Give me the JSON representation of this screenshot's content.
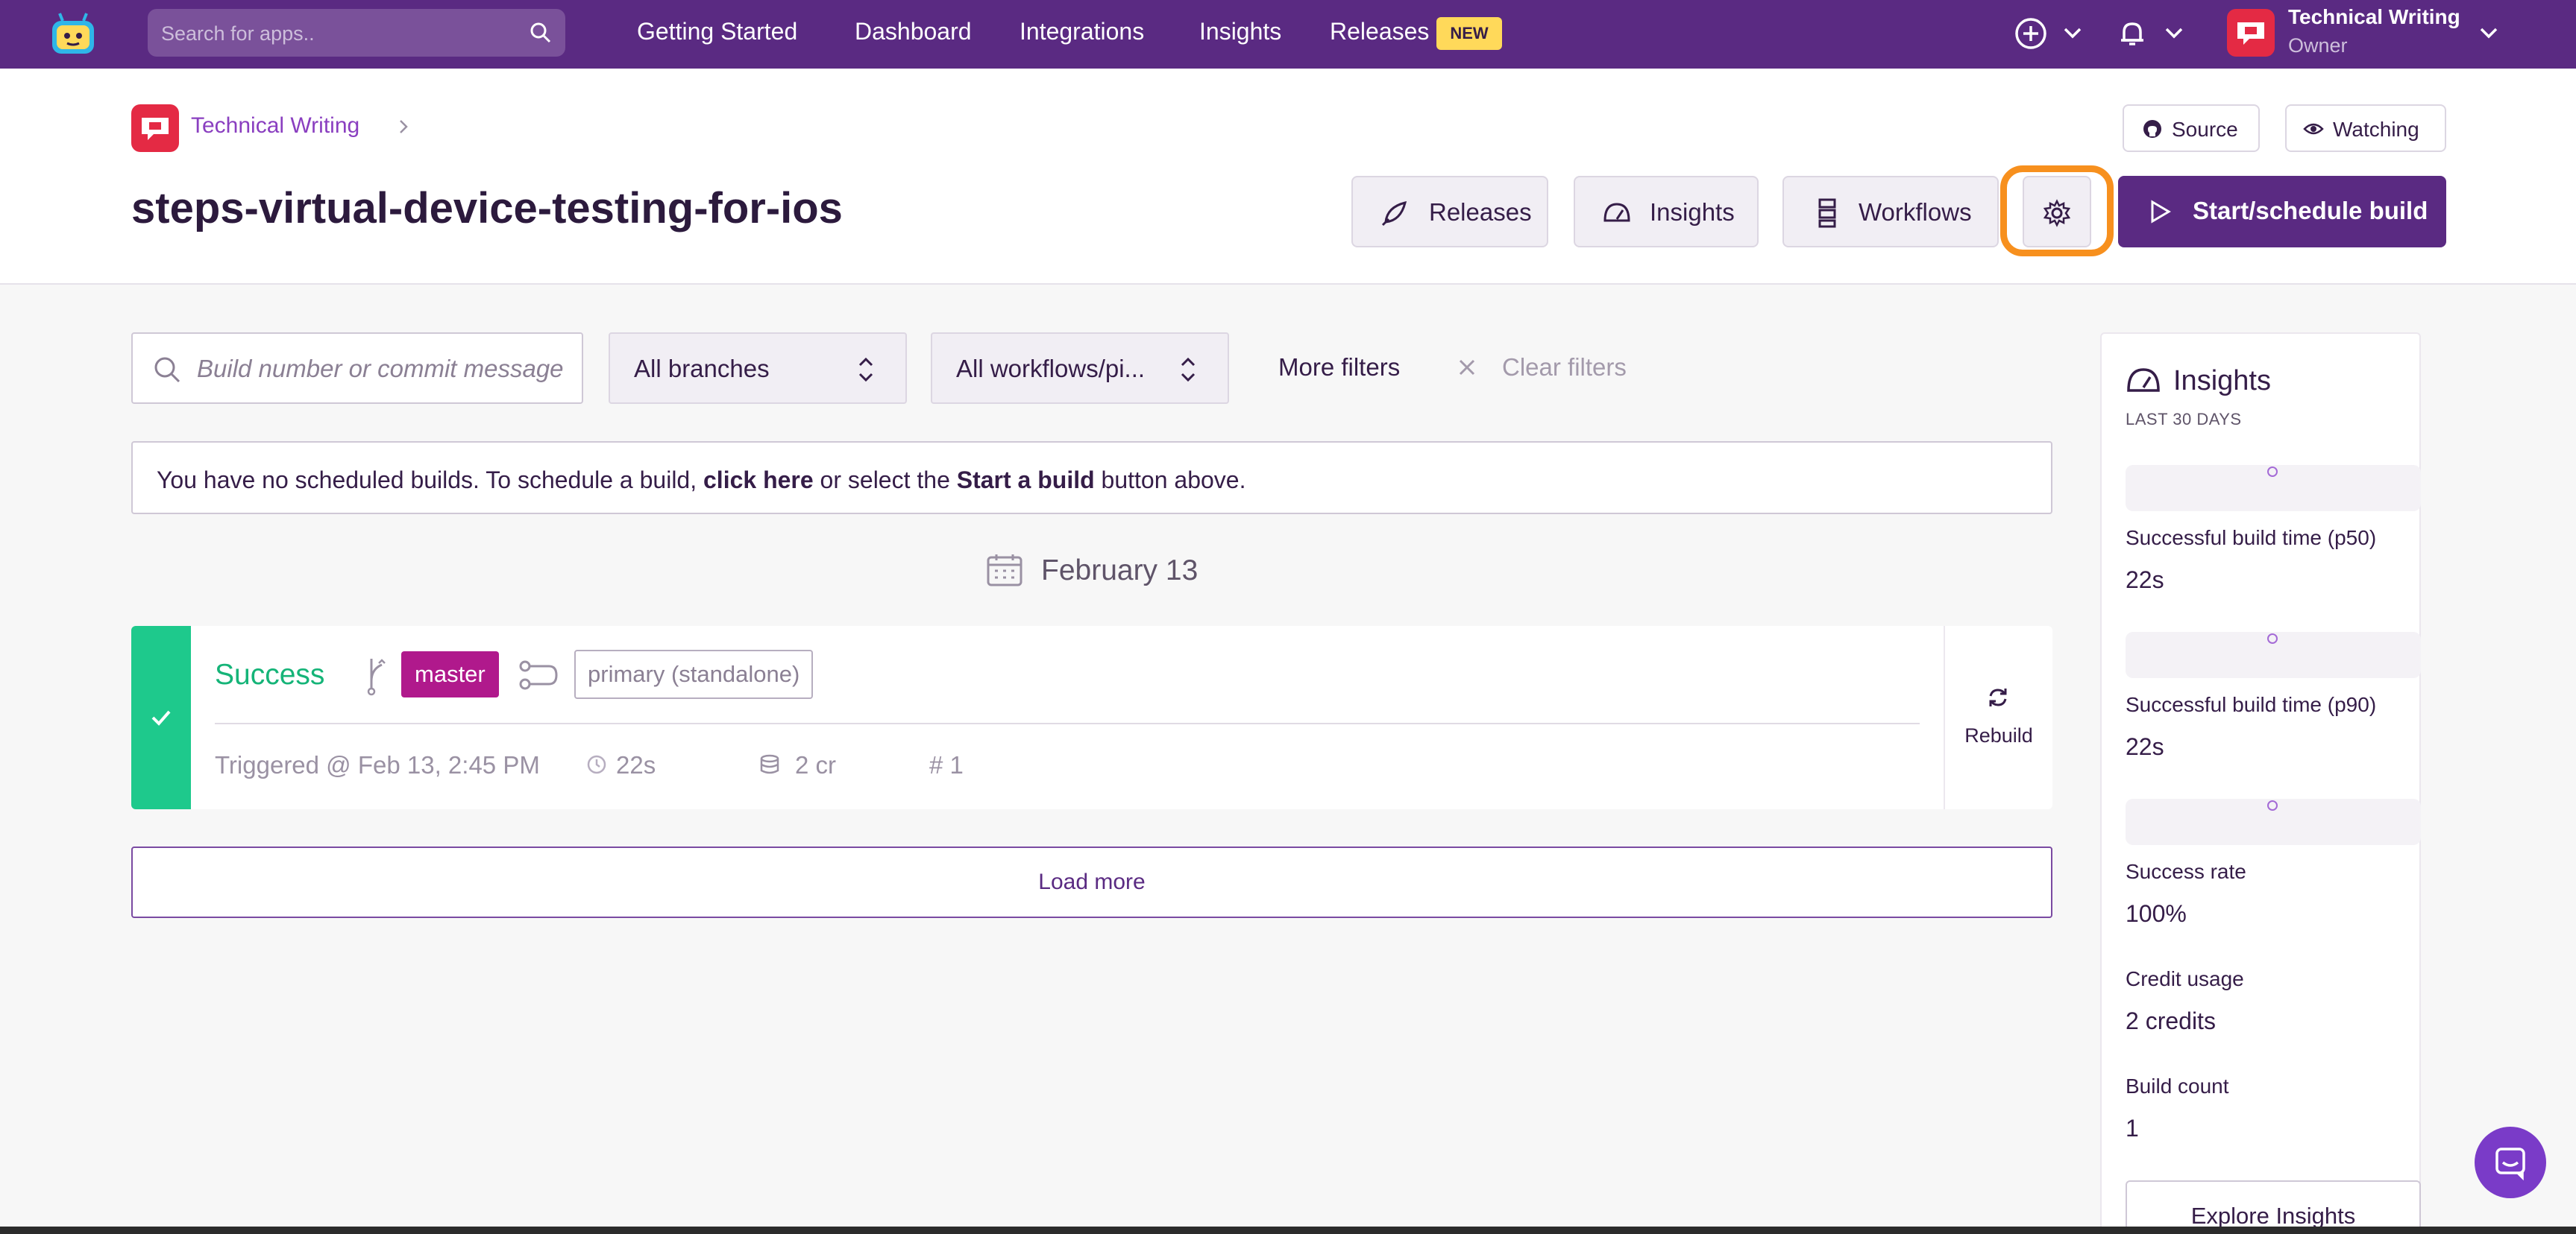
{
  "nav": {
    "search_placeholder": "Search for apps..",
    "links": [
      "Getting Started",
      "Dashboard",
      "Integrations",
      "Insights",
      "Releases"
    ],
    "new_badge": "NEW",
    "user_name": "Technical Writing",
    "user_role": "Owner"
  },
  "header": {
    "breadcrumb": "Technical Writing",
    "title": "steps-virtual-device-testing-for-ios",
    "source_label": "Source",
    "watching_label": "Watching",
    "releases_label": "Releases",
    "insights_label": "Insights",
    "workflows_label": "Workflows",
    "start_label": "Start/schedule build"
  },
  "filters": {
    "search_placeholder": "Build number or commit message",
    "branches": "All branches",
    "workflows": "All workflows/pi...",
    "more": "More filters",
    "clear": "Clear filters"
  },
  "notice": {
    "prefix": "You have no scheduled builds. To schedule a build, ",
    "link": "click here",
    "middle": " or select the ",
    "bold": "Start a build",
    "suffix": " button above."
  },
  "date_group": "February 13",
  "build": {
    "status": "Success",
    "branch": "master",
    "workflow": "primary (standalone)",
    "triggered": "Triggered @ Feb 13, 2:45 PM",
    "duration": "22s",
    "credits": "2 cr",
    "number": "# 1",
    "rebuild": "Rebuild"
  },
  "load_more": "Load more",
  "insights": {
    "title": "Insights",
    "subtitle": "LAST 30 DAYS",
    "metrics": [
      {
        "label": "Successful build time (p50)",
        "value": "22s"
      },
      {
        "label": "Successful build time (p90)",
        "value": "22s"
      },
      {
        "label": "Success rate",
        "value": "100%"
      },
      {
        "label": "Credit usage",
        "value": "2 credits"
      },
      {
        "label": "Build count",
        "value": "1"
      }
    ],
    "explore": "Explore Insights"
  },
  "colors": {
    "brand": "#5a2a82",
    "success": "#1ec98c",
    "branch_badge": "#b0198c",
    "highlight": "#f7901e"
  }
}
